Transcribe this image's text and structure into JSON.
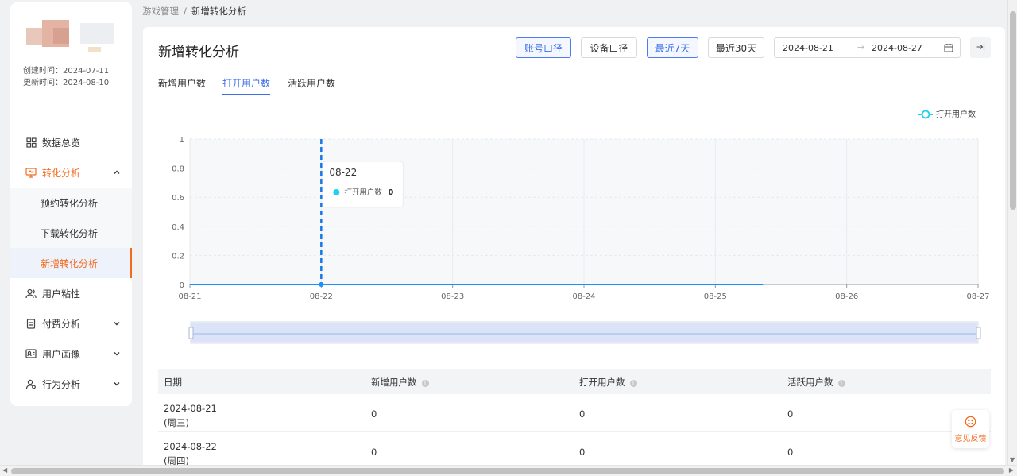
{
  "sidebar": {
    "created": "创建时间：2024-07-11",
    "updated": "更新时间：2024-08-10",
    "menu": [
      {
        "label": "数据总览",
        "icon": "grid-icon"
      },
      {
        "label": "转化分析",
        "icon": "monitor-icon",
        "expanded": true
      },
      {
        "label": "预约转化分析"
      },
      {
        "label": "下载转化分析"
      },
      {
        "label": "新增转化分析",
        "active": true
      },
      {
        "label": "用户粘性",
        "icon": "users-icon"
      },
      {
        "label": "付费分析",
        "icon": "bill-icon"
      },
      {
        "label": "用户画像",
        "icon": "id-card-icon"
      },
      {
        "label": "行为分析",
        "icon": "user-behavior-icon"
      }
    ]
  },
  "breadcrumb": {
    "parent": "游戏管理",
    "separator": "/",
    "current": "新增转化分析"
  },
  "header": {
    "title": "新增转化分析",
    "buttons": {
      "account": "账号口径",
      "device": "设备口径",
      "last7": "最近7天",
      "last30": "最近30天"
    },
    "date_start": "2024-08-21",
    "date_arrow": "→",
    "date_end": "2024-08-27"
  },
  "tabs": [
    "新增用户数",
    "打开用户数",
    "活跃用户数"
  ],
  "active_tab": 1,
  "colors": {
    "accent": "#3d6fe8",
    "brand_orange": "#f26b1d",
    "series": "#1890ff",
    "tooltip_dot": "#1fd1f0"
  },
  "chart_data": {
    "type": "line",
    "categories": [
      "08-21",
      "08-22",
      "08-23",
      "08-24",
      "08-25",
      "08-26",
      "08-27"
    ],
    "series": [
      {
        "name": "打开用户数",
        "values": [
          0,
          0,
          0,
          0,
          0,
          null,
          null
        ]
      }
    ],
    "ylim": [
      0,
      1
    ],
    "yticks": [
      "0",
      "0.2",
      "0.4",
      "0.6",
      "0.8",
      "1"
    ],
    "legend": "top-right",
    "tooltip": {
      "title": "08-22",
      "series": "打开用户数",
      "value": "0"
    },
    "grid": true,
    "data_zoom": true
  },
  "table": {
    "headers": [
      "日期",
      "新增用户数",
      "打开用户数",
      "活跃用户数"
    ],
    "rows": [
      {
        "date": "2024-08-21",
        "weekday": "(周三)",
        "new": "0",
        "open": "0",
        "active": "0"
      },
      {
        "date": "2024-08-22",
        "weekday": "(周四)",
        "new": "0",
        "open": "0",
        "active": "0"
      }
    ]
  },
  "feedback": {
    "label": "意见反馈"
  }
}
